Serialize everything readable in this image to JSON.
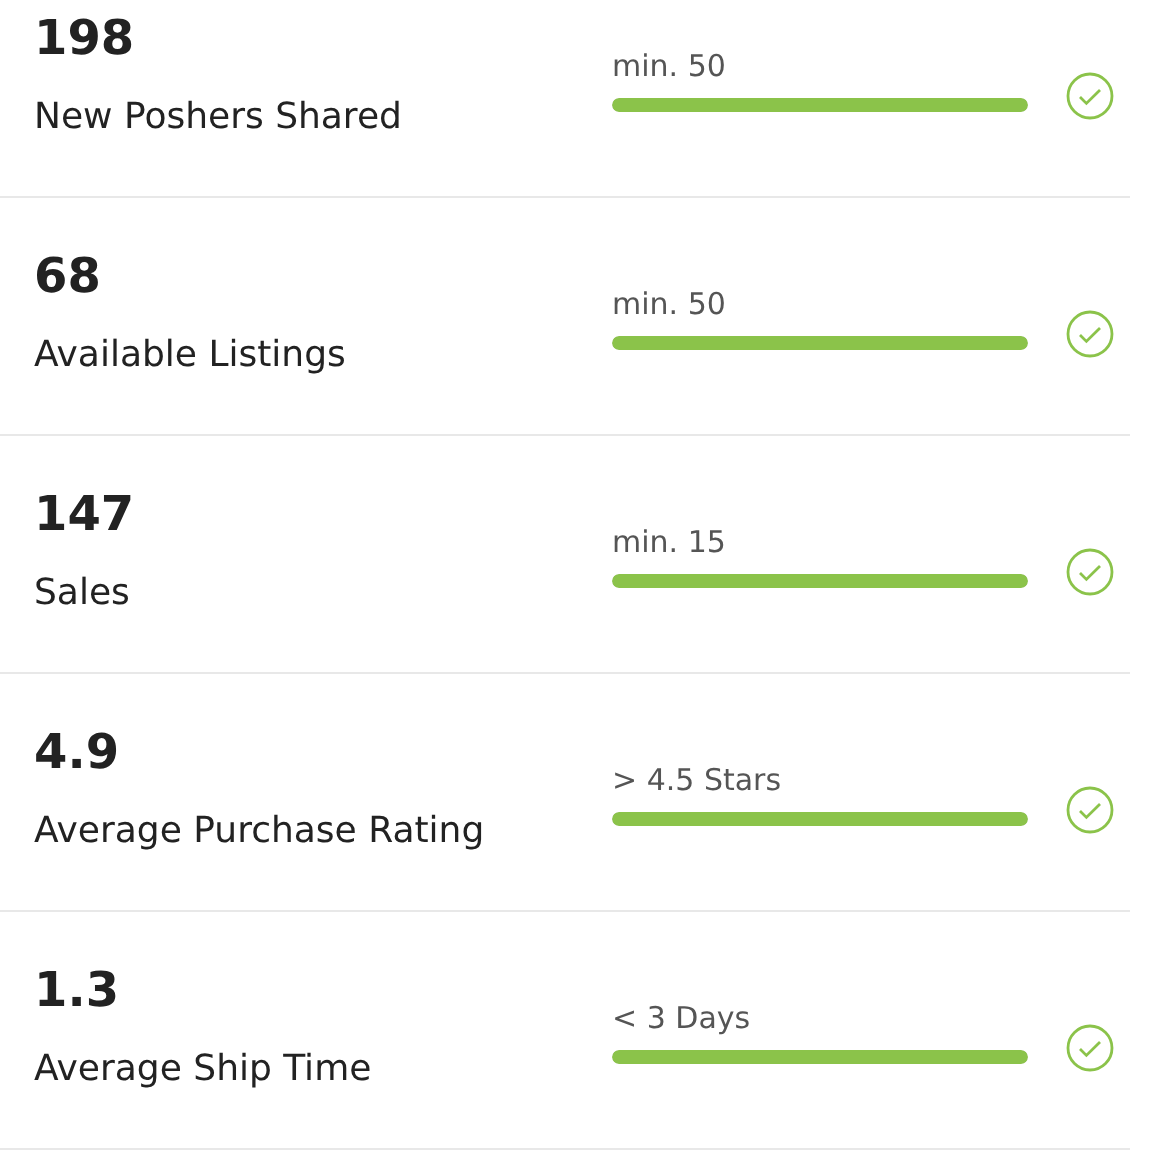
{
  "metrics": [
    {
      "value": "198",
      "label": "New Poshers Shared",
      "requirement": "min. 50",
      "level": 1,
      "met": true
    },
    {
      "value": "68",
      "label": "Available Listings",
      "requirement": "min. 50",
      "level": 1,
      "met": true
    },
    {
      "value": "147",
      "label": "Sales",
      "requirement": "min. 15",
      "level": 1,
      "met": true
    },
    {
      "value": "4.9",
      "label": "Average Purchase Rating",
      "requirement": "> 4.5 Stars",
      "level": 1,
      "met": true
    },
    {
      "value": "1.3",
      "label": "Average Ship Time",
      "requirement": "< 3 Days",
      "level": 1,
      "met": true
    }
  ]
}
